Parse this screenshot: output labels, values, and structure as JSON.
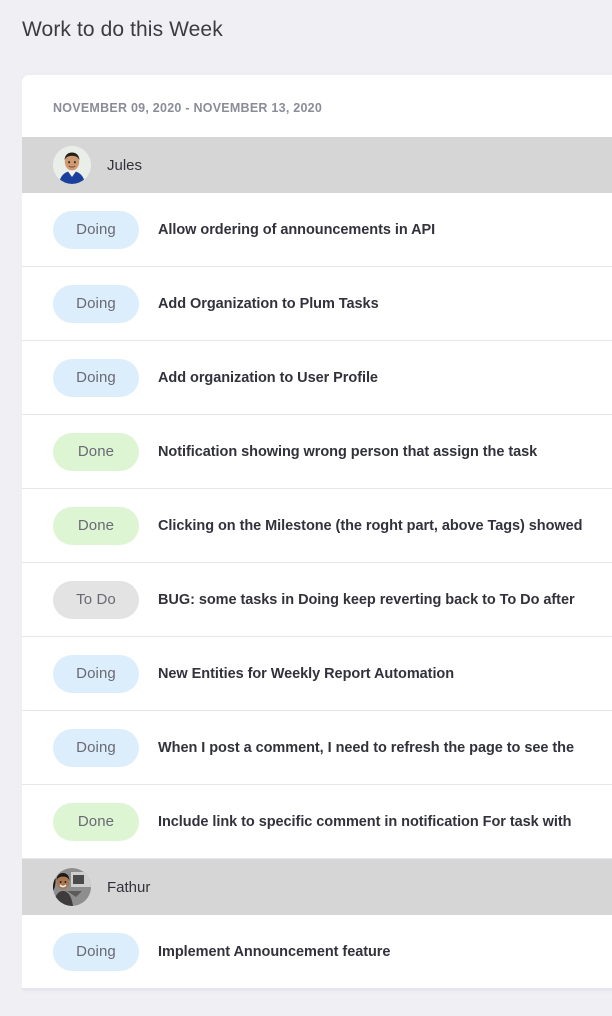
{
  "page": {
    "title": "Work to do this Week",
    "background_color": "#f0eff4"
  },
  "card": {
    "date_range": "NOVEMBER 09, 2020 - NOVEMBER 13, 2020",
    "background_color": "#ffffff"
  },
  "status_colors": {
    "doing": "#dcedfb",
    "done": "#ddf5d3",
    "todo": "#e3e3e3",
    "label": "#6a6a74"
  },
  "groups": [
    {
      "user": "Jules",
      "avatar": "user-avatar-jules",
      "tasks": [
        {
          "status": "Doing",
          "status_key": "doing",
          "title": "Allow ordering of announcements in API"
        },
        {
          "status": "Doing",
          "status_key": "doing",
          "title": "Add Organization to Plum Tasks"
        },
        {
          "status": "Doing",
          "status_key": "doing",
          "title": "Add organization to User Profile"
        },
        {
          "status": "Done",
          "status_key": "done",
          "title": "Notification showing wrong person that assign the task"
        },
        {
          "status": "Done",
          "status_key": "done",
          "title": "Clicking on the Milestone (the roght part, above Tags) showed"
        },
        {
          "status": "To Do",
          "status_key": "todo",
          "title": "BUG: some tasks in Doing keep reverting back to To Do after"
        },
        {
          "status": "Doing",
          "status_key": "doing",
          "title": "New Entities for Weekly Report Automation"
        },
        {
          "status": "Doing",
          "status_key": "doing",
          "title": "When I post a comment, I need to refresh the page to see the"
        },
        {
          "status": "Done",
          "status_key": "done",
          "title": "Include link to specific comment in notification For task with"
        }
      ]
    },
    {
      "user": "Fathur",
      "avatar": "user-avatar-fathur",
      "tasks": [
        {
          "status": "Doing",
          "status_key": "doing",
          "title": "Implement Announcement feature"
        }
      ]
    }
  ]
}
